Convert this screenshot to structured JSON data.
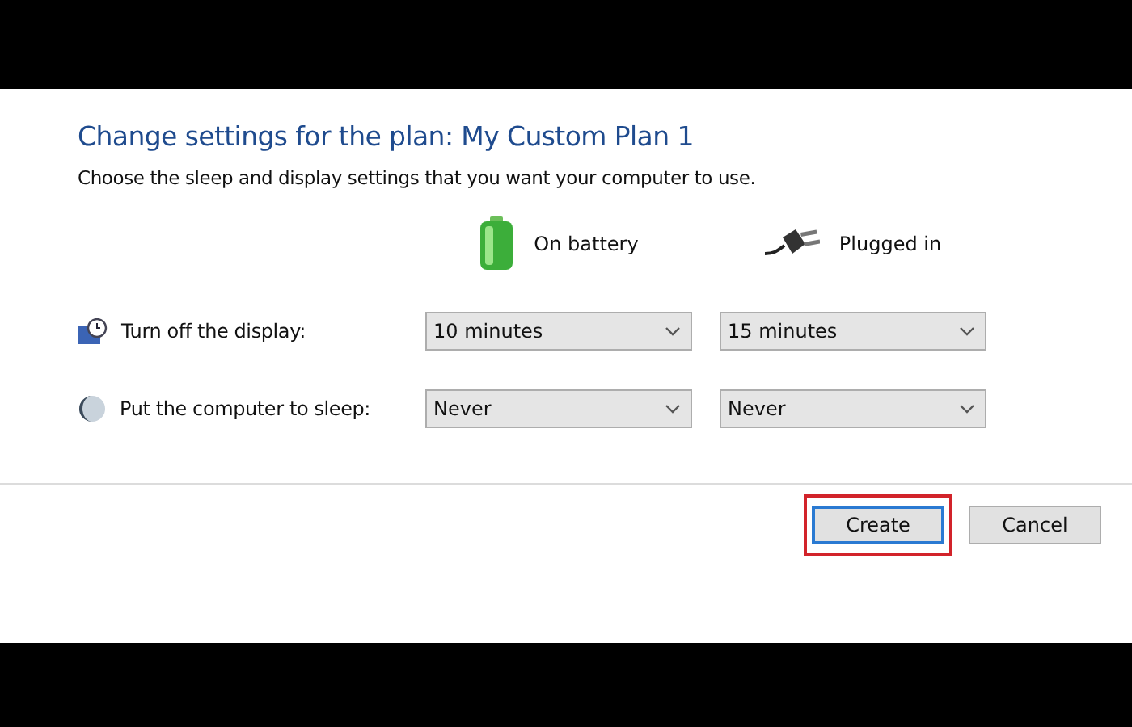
{
  "title": "Change settings for the plan: My Custom Plan 1",
  "description": "Choose the sleep and display settings that you want your computer to use.",
  "columns": [
    {
      "kind": "battery",
      "label": "On battery"
    },
    {
      "kind": "plug",
      "label": "Plugged in"
    }
  ],
  "settings": [
    {
      "kind": "display",
      "label": "Turn off the display:",
      "values": [
        "10 minutes",
        "15 minutes"
      ]
    },
    {
      "kind": "sleep",
      "label": "Put the computer to sleep:",
      "values": [
        "Never",
        "Never"
      ]
    }
  ],
  "buttons": [
    {
      "label": "Create",
      "default": true,
      "highlighted": true
    },
    {
      "label": "Cancel",
      "default": false,
      "highlighted": false
    }
  ]
}
